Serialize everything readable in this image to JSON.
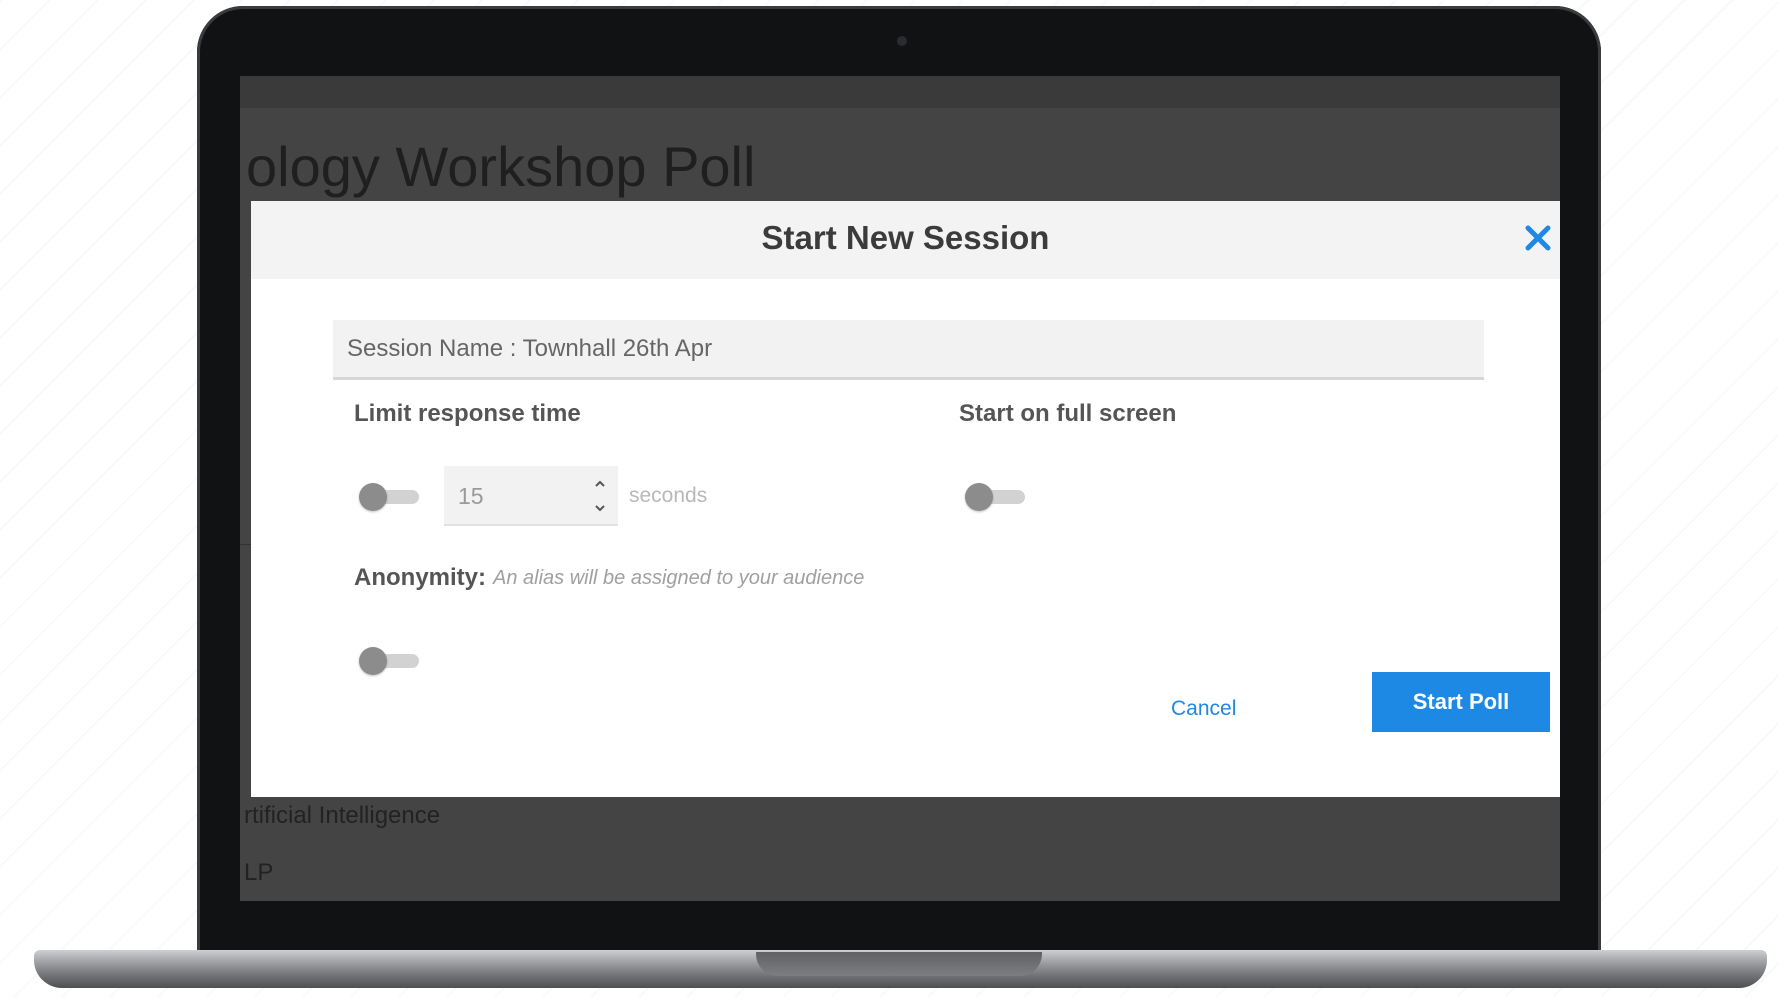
{
  "background_app": {
    "page_title": "ology Workshop Poll",
    "list_items": [
      "rtificial Intelligence",
      "LP"
    ]
  },
  "modal": {
    "title": "Start New Session",
    "close_icon": "close-icon",
    "session_name": {
      "value": "Session Name : Townhall 26th Apr"
    },
    "limit_response": {
      "label": "Limit response time",
      "enabled": false,
      "seconds_value": "15",
      "unit": "seconds"
    },
    "full_screen": {
      "label": "Start on full screen",
      "enabled": false
    },
    "anonymity": {
      "label": "Anonymity:",
      "hint": "An alias will be assigned to your audience",
      "enabled": false
    },
    "actions": {
      "cancel_label": "Cancel",
      "start_label": "Start Poll"
    }
  },
  "colors": {
    "accent": "#1e88e5",
    "overlay": "#444444",
    "header_bg": "#f3f3f3"
  }
}
